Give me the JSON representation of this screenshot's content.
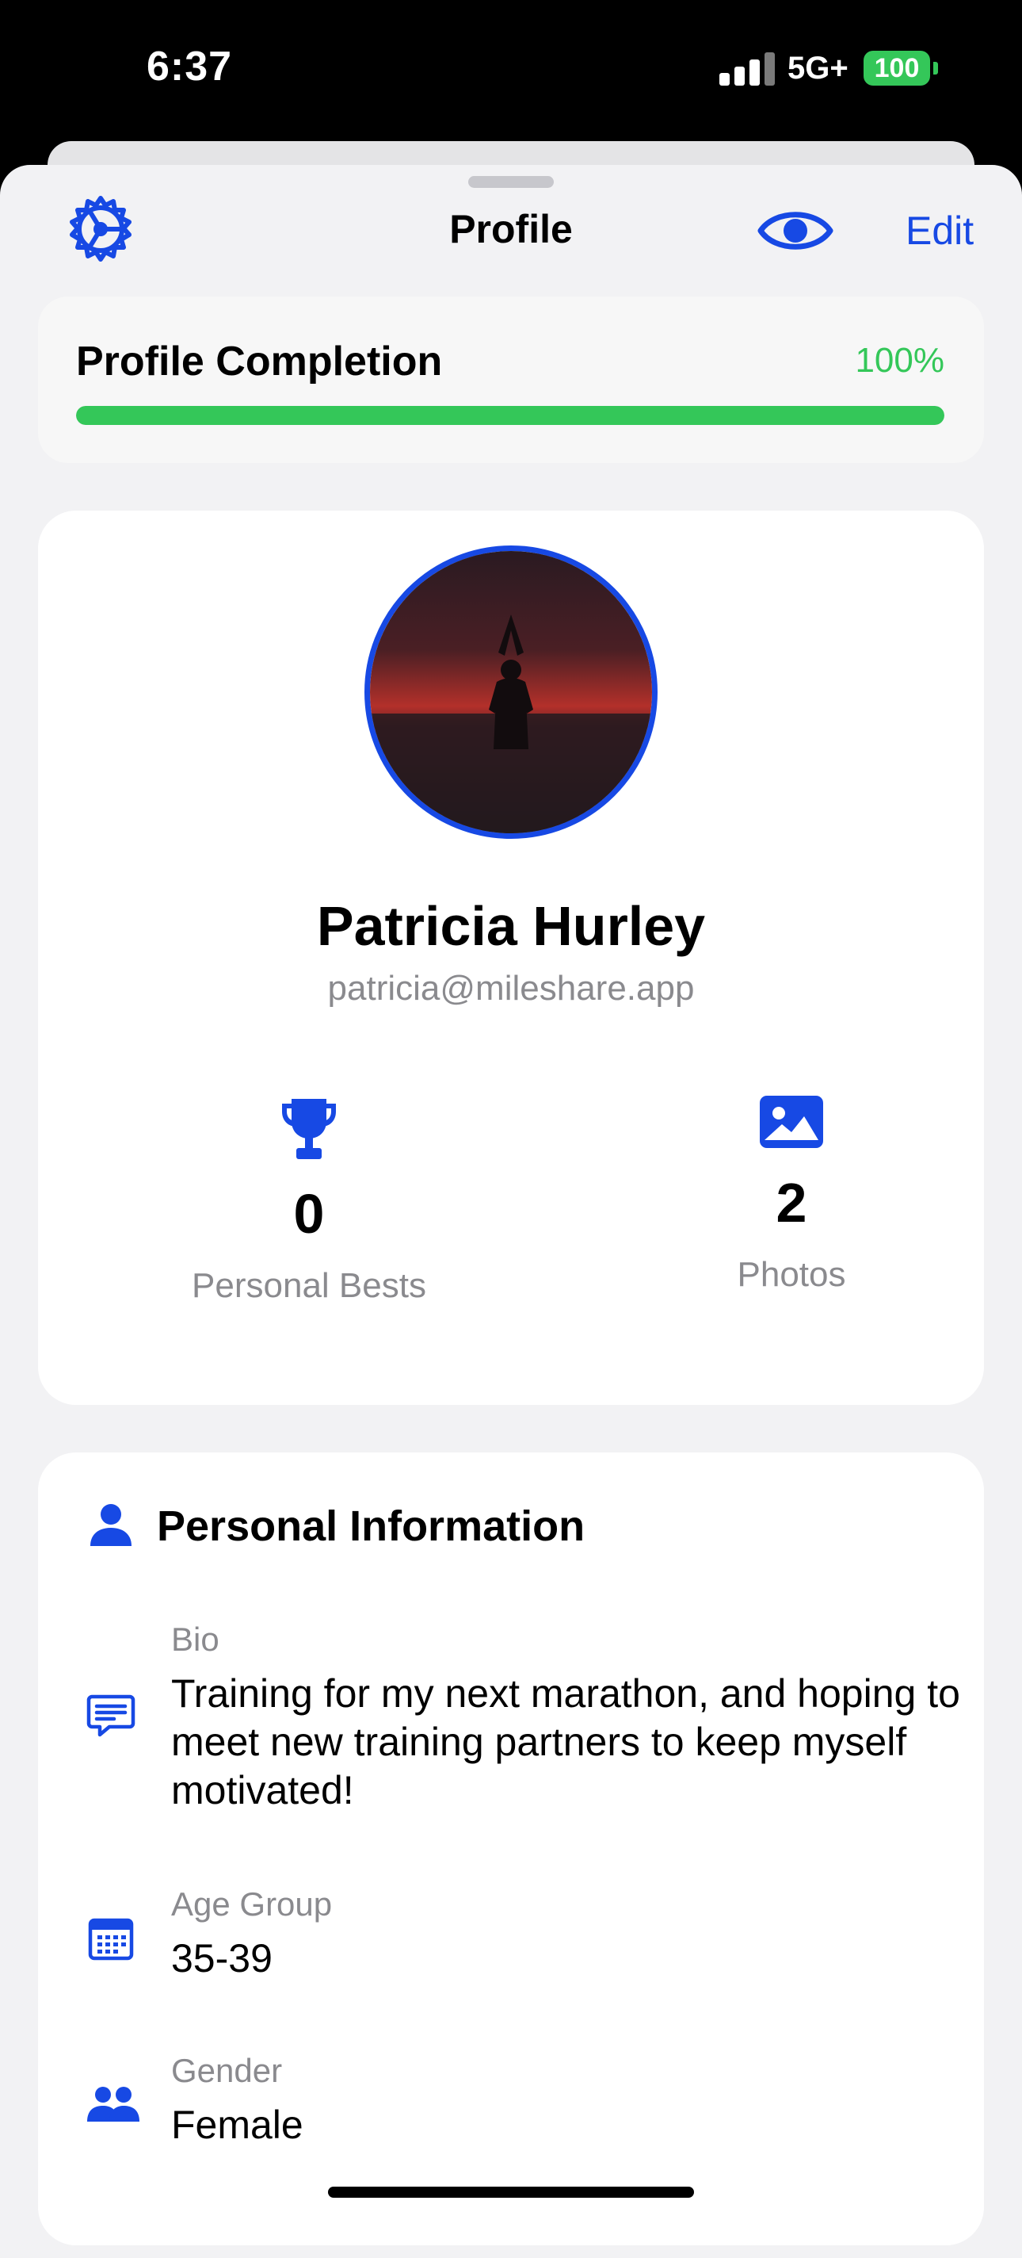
{
  "status_bar": {
    "time": "6:37",
    "network": "5G+",
    "battery": "100"
  },
  "nav": {
    "title": "Profile",
    "edit_label": "Edit",
    "settings_icon": "gear-icon",
    "preview_icon": "eye-icon"
  },
  "completion": {
    "title": "Profile Completion",
    "percent_label": "100%",
    "progress": 1.0
  },
  "profile": {
    "name": "Patricia Hurley",
    "email": "patricia@mileshare.app",
    "stats": [
      {
        "icon": "trophy-icon",
        "value": "0",
        "label": "Personal Bests"
      },
      {
        "icon": "photo-icon",
        "value": "2",
        "label": "Photos"
      }
    ]
  },
  "personal_info": {
    "title": "Personal Information",
    "rows": [
      {
        "icon": "chat-bubble-icon",
        "label": "Bio",
        "value": "Training for my next marathon, and hoping to meet new training partners to keep myself motivated!"
      },
      {
        "icon": "calendar-icon",
        "label": "Age Group",
        "value": "35-39"
      },
      {
        "icon": "people-icon",
        "label": "Gender",
        "value": "Female"
      }
    ]
  },
  "colors": {
    "accent": "#1749e4",
    "success": "#34c759",
    "secondary_text": "#8a8a8e"
  }
}
